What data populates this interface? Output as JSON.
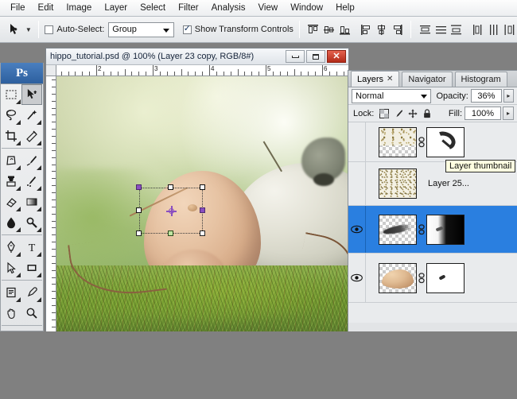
{
  "menubar": {
    "items": [
      {
        "label": "File"
      },
      {
        "label": "Edit"
      },
      {
        "label": "Image"
      },
      {
        "label": "Layer"
      },
      {
        "label": "Select"
      },
      {
        "label": "Filter"
      },
      {
        "label": "Analysis"
      },
      {
        "label": "View"
      },
      {
        "label": "Window"
      },
      {
        "label": "Help"
      }
    ]
  },
  "options_bar": {
    "tool_icon": "move-tool-icon",
    "auto_select_label": "Auto-Select:",
    "auto_select_checked": false,
    "auto_select_value": "Group",
    "show_transform_label": "Show Transform Controls",
    "show_transform_checked": true,
    "align_group_1": [
      "align-top-edges",
      "align-vertical-centers",
      "align-bottom-edges"
    ],
    "align_group_2": [
      "align-left-edges",
      "align-horizontal-centers",
      "align-right-edges"
    ],
    "distribute_group_1": [
      "distribute-top-edges",
      "distribute-vertical-centers",
      "distribute-bottom-edges"
    ],
    "distribute_group_2": [
      "distribute-left-edges",
      "distribute-horizontal-centers",
      "distribute-right-edges"
    ]
  },
  "toolbox": {
    "logo": "Ps",
    "tools": [
      {
        "name": "rectangular-marquee-tool",
        "selected": false
      },
      {
        "name": "move-tool",
        "selected": true
      },
      {
        "name": "lasso-tool",
        "selected": false
      },
      {
        "name": "magic-wand-tool",
        "selected": false
      },
      {
        "name": "crop-tool",
        "selected": false
      },
      {
        "name": "slice-tool",
        "selected": false
      },
      {
        "name": "patch-healing-tool",
        "selected": false
      },
      {
        "name": "brush-tool",
        "selected": false
      },
      {
        "name": "clone-stamp-tool",
        "selected": false
      },
      {
        "name": "history-brush-tool",
        "selected": false
      },
      {
        "name": "eraser-tool",
        "selected": false
      },
      {
        "name": "gradient-tool",
        "selected": false
      },
      {
        "name": "blur-tool",
        "selected": false
      },
      {
        "name": "dodge-tool",
        "selected": false
      },
      {
        "name": "pen-tool",
        "selected": false
      },
      {
        "name": "type-tool",
        "selected": false
      },
      {
        "name": "path-selection-tool",
        "selected": false
      },
      {
        "name": "rectangle-shape-tool",
        "selected": false
      },
      {
        "name": "notes-tool",
        "selected": false
      },
      {
        "name": "eyedropper-tool",
        "selected": false
      },
      {
        "name": "hand-tool",
        "selected": false
      },
      {
        "name": "zoom-tool",
        "selected": false
      }
    ],
    "foreground_color": "#ffffff",
    "background_color": "#000000"
  },
  "document": {
    "title": "hippo_tutorial.psd @ 100% (Layer 23 copy, RGB/8#)",
    "zoom": "100%",
    "active_layer": "Layer 23 copy",
    "color_mode": "RGB/8#",
    "window_buttons": [
      "minimize",
      "maximize",
      "close"
    ],
    "ruler_labels": [
      "2",
      "3",
      "4",
      "5",
      "6"
    ],
    "ruler_unit": "inches"
  },
  "panel": {
    "tabs": [
      {
        "label": "Layers",
        "active": true,
        "closable": true
      },
      {
        "label": "Navigator",
        "active": false,
        "closable": false
      },
      {
        "label": "Histogram",
        "active": false,
        "closable": false
      }
    ],
    "blend_mode": "Normal",
    "opacity_label": "Opacity:",
    "opacity_value": "36%",
    "lock_label": "Lock:",
    "lock_icons": [
      "lock-transparent-pixels-icon",
      "lock-image-pixels-icon",
      "lock-position-icon",
      "lock-all-icon"
    ],
    "fill_label": "Fill:",
    "fill_value": "100%",
    "selection_color": "#2a7fe0",
    "layers": [
      {
        "name": "",
        "visible": false,
        "selected": false,
        "thumbnail": "speckle-texture-thumbnail",
        "has_mask": true,
        "mask": "curved-brush-mask-thumbnail",
        "linked": true
      },
      {
        "name": "Layer 25...",
        "visible": false,
        "selected": false,
        "thumbnail": "noise-texture-thumbnail",
        "has_mask": false,
        "linked": false
      },
      {
        "name": "",
        "visible": true,
        "selected": true,
        "thumbnail": "dark-stroke-thumbnail",
        "has_mask": true,
        "mask": "gradient-mask-thumbnail",
        "linked": true
      },
      {
        "name": "",
        "visible": true,
        "selected": false,
        "thumbnail": "skin-shape-thumbnail",
        "has_mask": true,
        "mask": "small-mark-mask-thumbnail",
        "linked": true
      }
    ],
    "tooltip": "Layer thumbnail"
  },
  "canvas": {
    "selection": {
      "tool": "free-transform-bounding-box",
      "handles": [
        "top-left",
        "top-center",
        "top-right",
        "middle-left",
        "middle-right",
        "bottom-left",
        "bottom-center",
        "bottom-right"
      ],
      "pivot": "transform-reference-point"
    }
  }
}
